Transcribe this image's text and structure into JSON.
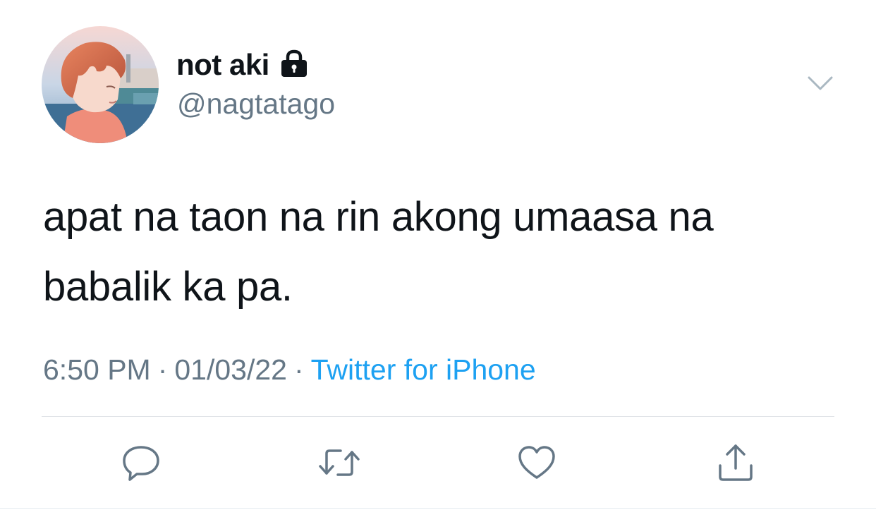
{
  "author": {
    "display_name": "not aki",
    "handle": "@nagtatago",
    "protected": true,
    "avatar_icon": "profile-photo"
  },
  "tweet": {
    "lines": [
      "apat na taon na rin akong umaasa na",
      "babalik ka pa."
    ]
  },
  "meta": {
    "time": "6:50 PM",
    "separator": "·",
    "date": "01/03/22",
    "source": "Twitter for iPhone"
  },
  "actions": {
    "reply_icon": "reply-icon",
    "retweet_icon": "retweet-icon",
    "like_icon": "heart-icon",
    "share_icon": "share-icon",
    "more_icon": "chevron-down-icon"
  },
  "colors": {
    "text": "#0f1419",
    "secondary": "#657786",
    "link": "#1da1f2",
    "icon": "#657786"
  }
}
